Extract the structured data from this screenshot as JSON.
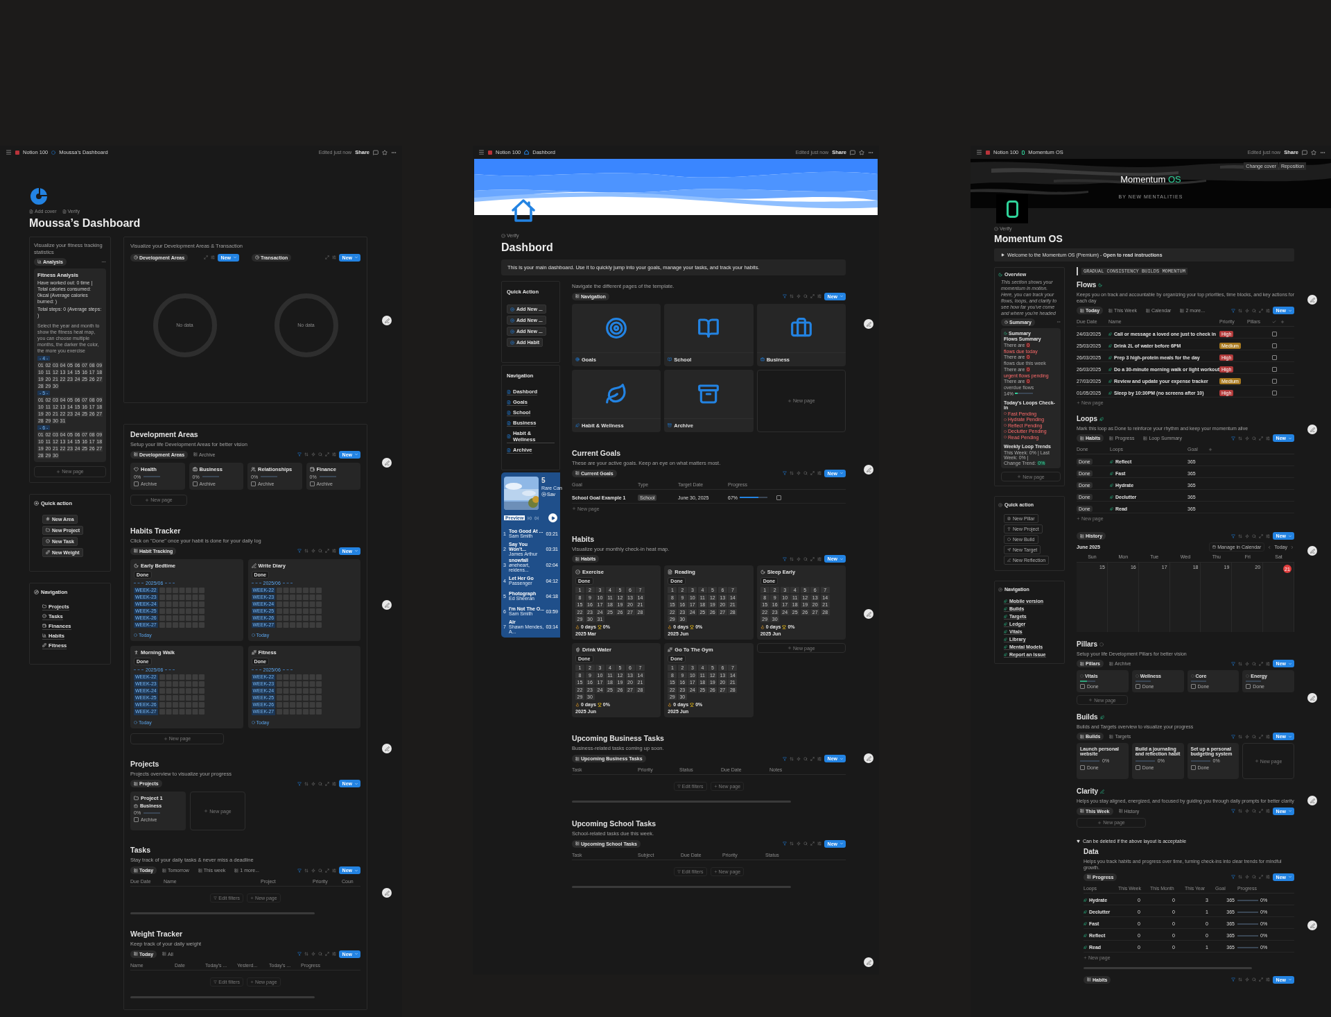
{
  "left": {
    "topbar": {
      "workspace": "Notion 100",
      "page": "Moussa’s Dashboard",
      "edited": "Edited just now",
      "share": "Share"
    },
    "page_actions": [
      "Add cover",
      "Verify"
    ],
    "title": "Moussa’s Dashboard",
    "fitness": {
      "description": "Visualize your fitness tracking statistics",
      "view": "Analysis",
      "card_title": "Fitness Analysis",
      "stats": [
        "Have worked out: 0 time | Total calories consumed: 0kcal (Average calories burned: )",
        "Total steps: 0 (Average steps: )"
      ],
      "hint": "Select the year and month to show the fitness heat map, you can choose multiple months, the darker the color, the more you exercise",
      "months": [
        {
          "label": "- 4 -",
          "days": [
            "01",
            "02",
            "03",
            "04",
            "05",
            "06",
            "07",
            "08",
            "09",
            "10",
            "11",
            "12",
            "13",
            "14",
            "15",
            "16",
            "17",
            "18",
            "19",
            "20",
            "21",
            "22",
            "23",
            "24",
            "25",
            "26",
            "27",
            "28",
            "29",
            "30"
          ]
        },
        {
          "label": "- 5 -",
          "days": [
            "01",
            "02",
            "03",
            "04",
            "05",
            "06",
            "07",
            "08",
            "09",
            "10",
            "11",
            "12",
            "13",
            "14",
            "15",
            "16",
            "17",
            "18",
            "19",
            "20",
            "21",
            "22",
            "23",
            "24",
            "25",
            "26",
            "27",
            "28",
            "29",
            "30",
            "31"
          ]
        },
        {
          "label": "- 6 -",
          "days": [
            "01",
            "02",
            "03",
            "04",
            "05",
            "06",
            "07",
            "08",
            "09",
            "10",
            "11",
            "12",
            "13",
            "14",
            "15",
            "16",
            "17",
            "18",
            "19",
            "20",
            "21",
            "22",
            "23",
            "24",
            "25",
            "26",
            "27",
            "28",
            "29",
            "30"
          ]
        }
      ],
      "new_page": "New page"
    },
    "quick_action": {
      "title": "Quick action",
      "buttons": [
        "New Area",
        "New Project",
        "New Task",
        "New Weight"
      ]
    },
    "navigation": {
      "title": "Navigation",
      "items": [
        "Projects",
        "Tasks",
        "Finances",
        "Habits",
        "Fitness"
      ]
    },
    "charts": {
      "description": "Visualize your Development Areas & Transaction",
      "views": [
        {
          "label": "Development Areas",
          "new": "New",
          "empty": "No data"
        },
        {
          "label": "Transaction",
          "new": "New",
          "empty": "No data"
        }
      ]
    },
    "development_areas": {
      "title": "Development Areas",
      "description": "Setup your life Development Areas for better vision",
      "views": [
        {
          "label": "Development Areas",
          "selected": true
        },
        {
          "label": "Archive",
          "selected": false
        }
      ],
      "new": "New",
      "cards": [
        {
          "name": "Health",
          "progress": "0%",
          "checkbox": "Archive",
          "checked": false
        },
        {
          "name": "Business",
          "progress": "0%",
          "checkbox": "Archive",
          "checked": false
        },
        {
          "name": "Relationships",
          "progress": "0%",
          "checkbox": "Archive",
          "checked": false
        },
        {
          "name": "Finance",
          "progress": "0%",
          "checkbox": "Archive",
          "checked": false
        }
      ],
      "new_page": "New page"
    },
    "habits_tracker": {
      "title": "Habits Tracker",
      "description": "Click on \"Done\" once your habit is done for your daily log",
      "views": [
        {
          "label": "Habit Tracking",
          "selected": true
        }
      ],
      "new": "New",
      "cards": [
        {
          "name": "Early Bedtime",
          "status": "Done",
          "month": "2025/06",
          "weeks": [
            "WEEK-22",
            "WEEK-23",
            "WEEK-24",
            "WEEK-25",
            "WEEK-26",
            "WEEK-27"
          ],
          "footer": "Today"
        },
        {
          "name": "Write Diary",
          "status": "Done",
          "month": "2025/06",
          "weeks": [
            "WEEK-22",
            "WEEK-23",
            "WEEK-24",
            "WEEK-25",
            "WEEK-26",
            "WEEK-27"
          ],
          "footer": "Today"
        },
        {
          "name": "Morning Walk",
          "status": "Done",
          "month": "2025/06",
          "weeks": [
            "WEEK-22",
            "WEEK-23",
            "WEEK-24",
            "WEEK-25",
            "WEEK-26",
            "WEEK-27"
          ],
          "footer": "Today"
        },
        {
          "name": "Fitness",
          "status": "Done",
          "month": "2025/06",
          "weeks": [
            "WEEK-22",
            "WEEK-23",
            "WEEK-24",
            "WEEK-25",
            "WEEK-26",
            "WEEK-27"
          ],
          "footer": "Today"
        }
      ],
      "new_page": "New page"
    },
    "projects": {
      "title": "Projects",
      "description": "Projects overview to visualize your progress",
      "views": [
        {
          "label": "Projects",
          "selected": true
        }
      ],
      "new": "New",
      "cards": [
        {
          "name": "Project 1",
          "area": "Business",
          "progress": "0%",
          "checkbox": "Archive",
          "checked": false
        }
      ],
      "new_page": "New page"
    },
    "tasks": {
      "title": "Tasks",
      "description": "Stay track of your daily tasks & never miss a deadline",
      "views": [
        {
          "label": "Today",
          "selected": true
        },
        {
          "label": "Tomorrow",
          "selected": false
        },
        {
          "label": "This week",
          "selected": false
        },
        {
          "label": "1 more...",
          "selected": false
        }
      ],
      "new": "New",
      "columns": [
        "Due Date",
        "Name",
        "Project",
        "Priority",
        "Coun"
      ],
      "footer": [
        "Edit filters",
        "New page"
      ]
    },
    "weight_tracker": {
      "title": "Weight Tracker",
      "description": "Keep track of your daily weight",
      "views": [
        {
          "label": "Today",
          "selected": true
        },
        {
          "label": "All",
          "selected": false
        }
      ],
      "new": "New",
      "columns": [
        "Name",
        "Date",
        "Today's ...",
        "Yesterd...",
        "Today's ...",
        "Progress"
      ],
      "footer": [
        "Edit filters",
        "New page"
      ]
    }
  },
  "middle": {
    "topbar": {
      "workspace": "Notion 100",
      "page": "Dashbord",
      "edited": "Edited just now",
      "share": "Share"
    },
    "page_actions": [
      "Verify"
    ],
    "title": "Dashbord",
    "callout": "This is your main dashboard. Use it to quickly jump into your goals, manage your tasks, and track your habits.",
    "quick_action": {
      "title": "Quick Action",
      "buttons": [
        "Add New ...",
        "Add New ...",
        "Add New ...",
        "Add Habit"
      ]
    },
    "navigation": {
      "title": "Navigation",
      "items": [
        "Dashbord",
        "Goals",
        "School",
        "Business",
        "Habit & Wellness",
        "Archive"
      ]
    },
    "music": {
      "count": "5",
      "subtitle": "Rare Can",
      "save": "Sav",
      "badge": "Preview",
      "tracks": [
        {
          "no": "1",
          "title": "Too Good At ...",
          "artist": "Sam Smith",
          "time": "03:21"
        },
        {
          "no": "2",
          "title": "Say You Won't...",
          "artist": "James Arthur",
          "time": "03:31"
        },
        {
          "no": "3",
          "title": "snowfall",
          "artist": "øneheart, reidens...",
          "time": "02:04"
        },
        {
          "no": "4",
          "title": "Let Her Go",
          "artist": "Passenger",
          "time": "04:12"
        },
        {
          "no": "5",
          "title": "Photograph",
          "artist": "Ed Sheeran",
          "time": "04:18"
        },
        {
          "no": "6",
          "title": "I'm Not The O...",
          "artist": "Sam Smith",
          "time": "03:59"
        },
        {
          "no": "7",
          "title": "Air",
          "artist": "Shawn Mendes, A...",
          "time": "03:14"
        }
      ]
    },
    "pages": {
      "description": "Navigate the different pages of the template.",
      "views": [
        {
          "label": "Navigation",
          "selected": true
        }
      ],
      "new": "New",
      "cards": [
        "Goals",
        "School",
        "Business",
        "Habit & Wellness",
        "Archive"
      ],
      "new_page": "New page"
    },
    "current_goals": {
      "title": "Current Goals",
      "description": "These are your active goals. Keep an eye on what matters most.",
      "views": [
        {
          "label": "Current Goals",
          "selected": true
        }
      ],
      "new": "New",
      "columns": [
        "Goal",
        "Type",
        "Target Date",
        "Progress"
      ],
      "rows": [
        {
          "goal": "School Goal Example 1",
          "type": "School",
          "date": "June 30, 2025",
          "progress": "67%",
          "level": 0.67,
          "checked": false
        }
      ],
      "new_page": "New page"
    },
    "habits": {
      "title": "Habits",
      "description": "Visualize your monthly check-in heat map.",
      "views": [
        {
          "label": "Habits",
          "selected": true
        }
      ],
      "new": "New",
      "cards": [
        {
          "name": "Exercise",
          "status": "Done",
          "days": [
            "1",
            "2",
            "3",
            "4",
            "5",
            "6",
            "7",
            "8",
            "9",
            "10",
            "11",
            "12",
            "13",
            "14",
            "15",
            "16",
            "17",
            "18",
            "19",
            "20",
            "21",
            "22",
            "23",
            "24",
            "25",
            "26",
            "27",
            "28",
            "29",
            "30",
            "31"
          ],
          "streak": "0 days",
          "rate": "0%",
          "month": "2025 Mar"
        },
        {
          "name": "Reading",
          "status": "Done",
          "days": [
            "1",
            "2",
            "3",
            "4",
            "5",
            "6",
            "7",
            "8",
            "9",
            "10",
            "11",
            "12",
            "13",
            "14",
            "15",
            "16",
            "17",
            "18",
            "19",
            "20",
            "21",
            "22",
            "23",
            "24",
            "25",
            "26",
            "27",
            "28",
            "29",
            "30"
          ],
          "streak": "0 days",
          "rate": "0%",
          "month": "2025 Jun"
        },
        {
          "name": "Sleep Early",
          "status": "Done",
          "days": [
            "1",
            "2",
            "3",
            "4",
            "5",
            "6",
            "7",
            "8",
            "9",
            "10",
            "11",
            "12",
            "13",
            "14",
            "15",
            "16",
            "17",
            "18",
            "19",
            "20",
            "21",
            "22",
            "23",
            "24",
            "25",
            "26",
            "27",
            "28",
            "29",
            "30"
          ],
          "streak": "0 days",
          "rate": "0%",
          "month": "2025 Jun"
        },
        {
          "name": "Drink Water",
          "status": "Done",
          "days": [
            "1",
            "2",
            "3",
            "4",
            "5",
            "6",
            "7",
            "8",
            "9",
            "10",
            "11",
            "12",
            "13",
            "14",
            "15",
            "16",
            "17",
            "18",
            "19",
            "20",
            "21",
            "22",
            "23",
            "24",
            "25",
            "26",
            "27",
            "28",
            "29",
            "30"
          ],
          "streak": "0 days",
          "rate": "0%",
          "month": "2025 Jun"
        },
        {
          "name": "Go To The Gym",
          "status": "Done",
          "days": [
            "1",
            "2",
            "3",
            "4",
            "5",
            "6",
            "7",
            "8",
            "9",
            "10",
            "11",
            "12",
            "13",
            "14",
            "15",
            "16",
            "17",
            "18",
            "19",
            "20",
            "21",
            "22",
            "23",
            "24",
            "25",
            "26",
            "27",
            "28",
            "29",
            "30"
          ],
          "streak": "0 days",
          "rate": "0%",
          "month": "2025 Jun"
        }
      ],
      "new_page": "New page"
    },
    "business_tasks": {
      "title": "Upcoming Business Tasks",
      "description": "Business-related tasks coming up soon.",
      "views": [
        {
          "label": "Upcoming Business Tasks",
          "selected": true
        }
      ],
      "new": "New",
      "columns": [
        "Task",
        "Priority",
        "Status",
        "Due Date",
        "Notes"
      ],
      "footer": [
        "Edit filters",
        "New page"
      ]
    },
    "school_tasks": {
      "title": "Upcoming School Tasks",
      "description": "School-related tasks due this week.",
      "views": [
        {
          "label": "Upcoming School Tasks",
          "selected": true
        }
      ],
      "new": "New",
      "columns": [
        "Task",
        "Subject",
        "Due Date",
        "Priority",
        "Status"
      ],
      "footer": [
        "Edit filters",
        "New page"
      ]
    }
  },
  "right": {
    "topbar": {
      "workspace": "Notion 100",
      "page": "Momentum OS",
      "edited": "Edited just now",
      "share": "Share"
    },
    "cover": {
      "title": "Momentum",
      "title_accent": "OS",
      "byline": "BY NEW MENTALITIES",
      "actions": [
        "Change cover",
        "Reposition"
      ]
    },
    "page_actions": [
      "Verify"
    ],
    "title": "Momentum OS",
    "callout": "Welcome to the Momentum OS (Premium) - **Open to read instructions**",
    "overview": {
      "title": "Overview",
      "text": "This section shows your momentum in motion. Here, you can track your flows, loops, and clarity to see how far you've come and where you're headed",
      "view": "Summary",
      "summary": {
        "title": "Summary",
        "heading": "Flows Summary",
        "lines": [
          {
            "lead": "There are",
            "count": "0",
            "rest": "flows due today",
            "alert": true
          },
          {
            "lead": "There are",
            "count": "0",
            "rest": "flows due this week",
            "alert": false
          },
          {
            "lead": "There are",
            "count": "0",
            "rest": "urgent flows pending",
            "alert": true
          },
          {
            "lead": "There are",
            "count": "0",
            "rest": "overdue flows",
            "alert": false
          }
        ],
        "percent": "14%",
        "level": 0.14,
        "loops_heading": "Today's Loops Check-in",
        "loops": [
          "Fast Pending",
          "Hydrate Pending",
          "Reflect Pending",
          "Declutter Pending",
          "Read Pending"
        ],
        "trends_heading": "Weekly Loop Trends",
        "trend": "This Week: 0% | Last Week: 0% |",
        "change": "Change Trend:",
        "change_value": "0%"
      },
      "new_page": "New page"
    },
    "quick_action": {
      "title": "Quick action",
      "buttons": [
        "New Pillar",
        "New Project",
        "New Build",
        "New Target",
        "New Reflection"
      ]
    },
    "navigation": {
      "title": "Navigation",
      "items": [
        "Mobile version",
        "Builds",
        "Targets",
        "Ledger",
        "Vitals",
        "Library",
        "Mental Models",
        "Report an Issue"
      ]
    },
    "quote": "GRADUAL CONSISTENCY BUILDS MOMENTUM",
    "flows": {
      "title": "Flows",
      "description": "Keeps you on track and accountable by organizing your top priorities, time blocks, and key actions for each day",
      "views": [
        {
          "label": "Today",
          "selected": true
        },
        {
          "label": "This Week",
          "selected": false
        },
        {
          "label": "Calendar",
          "selected": false
        },
        {
          "label": "2 more...",
          "selected": false
        }
      ],
      "new": "New",
      "columns": [
        "Due Date",
        "Name",
        "Priority",
        "Pillars"
      ],
      "rows": [
        {
          "date": "24/03/2025",
          "name": "Call or message a loved one just to check in",
          "priority": "High",
          "color": "#b23a3a",
          "checked": false
        },
        {
          "date": "25/03/2025",
          "name": "Drink 2L of water before 6PM",
          "priority": "Medium",
          "color": "#a8791f",
          "checked": false
        },
        {
          "date": "26/03/2025",
          "name": "Prep 3 high-protein meals for the day",
          "priority": "High",
          "color": "#b23a3a",
          "checked": false
        },
        {
          "date": "26/03/2025",
          "name": "Do a 30-minute morning walk or light workout",
          "priority": "High",
          "color": "#b23a3a",
          "checked": false
        },
        {
          "date": "27/03/2025",
          "name": "Review and update your expense tracker",
          "priority": "Medium",
          "color": "#a8791f",
          "checked": false
        },
        {
          "date": "01/05/2025",
          "name": "Sleep by 10:30PM (no screens after 10)",
          "priority": "High",
          "color": "#b23a3a",
          "checked": false
        }
      ],
      "new_page": "New page"
    },
    "loops": {
      "title": "Loops",
      "description": "Mark this loop as Done to reinforce your rhythm and keep your momentum alive",
      "views": [
        {
          "label": "Habits",
          "selected": true
        },
        {
          "label": "Progress",
          "selected": false
        },
        {
          "label": "Loop Summary",
          "selected": false
        }
      ],
      "new": "New",
      "columns": [
        "Done",
        "Loops",
        "Goal"
      ],
      "rows": [
        {
          "done": "Done",
          "name": "Reflect",
          "goal": "365"
        },
        {
          "done": "Done",
          "name": "Fast",
          "goal": "365"
        },
        {
          "done": "Done",
          "name": "Hydrate",
          "goal": "365"
        },
        {
          "done": "Done",
          "name": "Declutter",
          "goal": "365"
        },
        {
          "done": "Done",
          "name": "Read",
          "goal": "365"
        }
      ],
      "new_page": "New page"
    },
    "history": {
      "views": [
        {
          "label": "History",
          "selected": true
        }
      ],
      "new": "New",
      "month": "June 2025",
      "manage": "Manage in Calendar",
      "today": "Today",
      "weekdays": [
        "Sun",
        "Mon",
        "Tue",
        "Wed",
        "Thu",
        "Fri",
        "Sat"
      ],
      "dates": [
        {
          "label": "15",
          "today": false
        },
        {
          "label": "16",
          "today": false
        },
        {
          "label": "17",
          "today": false
        },
        {
          "label": "18",
          "today": false
        },
        {
          "label": "19",
          "today": false
        },
        {
          "label": "20",
          "today": false
        },
        {
          "label": "21",
          "today": true
        }
      ]
    },
    "pillars": {
      "title": "Pillars",
      "description": "Setup your life Development Pillars for better vision",
      "views": [
        {
          "label": "Pillars",
          "selected": true
        },
        {
          "label": "Archive",
          "selected": false
        }
      ],
      "new": "New",
      "cards": [
        {
          "name": "Vitals",
          "level": 0.45,
          "checkbox": "Done",
          "checked": false
        },
        {
          "name": "Wellness",
          "checkbox": "Done",
          "checked": false
        },
        {
          "name": "Core",
          "checkbox": "Done",
          "checked": false
        },
        {
          "name": "Energy",
          "checkbox": "Done",
          "checked": false
        }
      ],
      "new_page": "New page"
    },
    "builds": {
      "title": "Builds",
      "description": "Builds and Targets overview to visualize your progress",
      "views": [
        {
          "label": "Builds",
          "selected": true
        },
        {
          "label": "Targets",
          "selected": false
        }
      ],
      "new": "New",
      "cards": [
        {
          "name": "Launch personal website",
          "progress": "0%",
          "checkbox": "Done",
          "checked": false
        },
        {
          "name": "Build a journaling and reflection habit",
          "progress": "0%",
          "checkbox": "Done",
          "checked": false
        },
        {
          "name": "Set up a personal budgeting system",
          "progress": "0%",
          "checkbox": "Done",
          "checked": false
        }
      ],
      "new_page": "New page"
    },
    "clarity": {
      "title": "Clarity",
      "description": "Helps you stay aligned, energized, and focused by guiding you through daily prompts for better clarity",
      "views": [
        {
          "label": "This Week",
          "selected": true
        },
        {
          "label": "History",
          "selected": false
        }
      ],
      "new": "New",
      "new_page": "New page"
    },
    "toggle": {
      "label": "Can be deleted if the above layout is acceptable",
      "expanded": true
    },
    "data": {
      "title": "Data",
      "description": "Helps you track habits and progress over time, turning check-ins into clear trends for mindful growth.",
      "views": [
        {
          "label": "Progress",
          "selected": true
        }
      ],
      "new": "New",
      "columns": [
        "Loops",
        "This Week",
        "This Month",
        "This Year",
        "Goal",
        "Progress"
      ],
      "rows": [
        {
          "name": "Hydrate",
          "week": "0",
          "month": "0",
          "year": "3",
          "goal": "365",
          "progress": "0%"
        },
        {
          "name": "Declutter",
          "week": "0",
          "month": "0",
          "year": "1",
          "goal": "365",
          "progress": "0%"
        },
        {
          "name": "Fast",
          "week": "0",
          "month": "0",
          "year": "0",
          "goal": "365",
          "progress": "0%"
        },
        {
          "name": "Reflect",
          "week": "0",
          "month": "0",
          "year": "0",
          "goal": "365",
          "progress": "0%"
        },
        {
          "name": "Read",
          "week": "0",
          "month": "0",
          "year": "1",
          "goal": "365",
          "progress": "0%"
        }
      ],
      "new_page": "New page"
    },
    "bottom_view": {
      "views": [
        {
          "label": "Habits",
          "selected": true
        }
      ],
      "new": "New"
    }
  }
}
